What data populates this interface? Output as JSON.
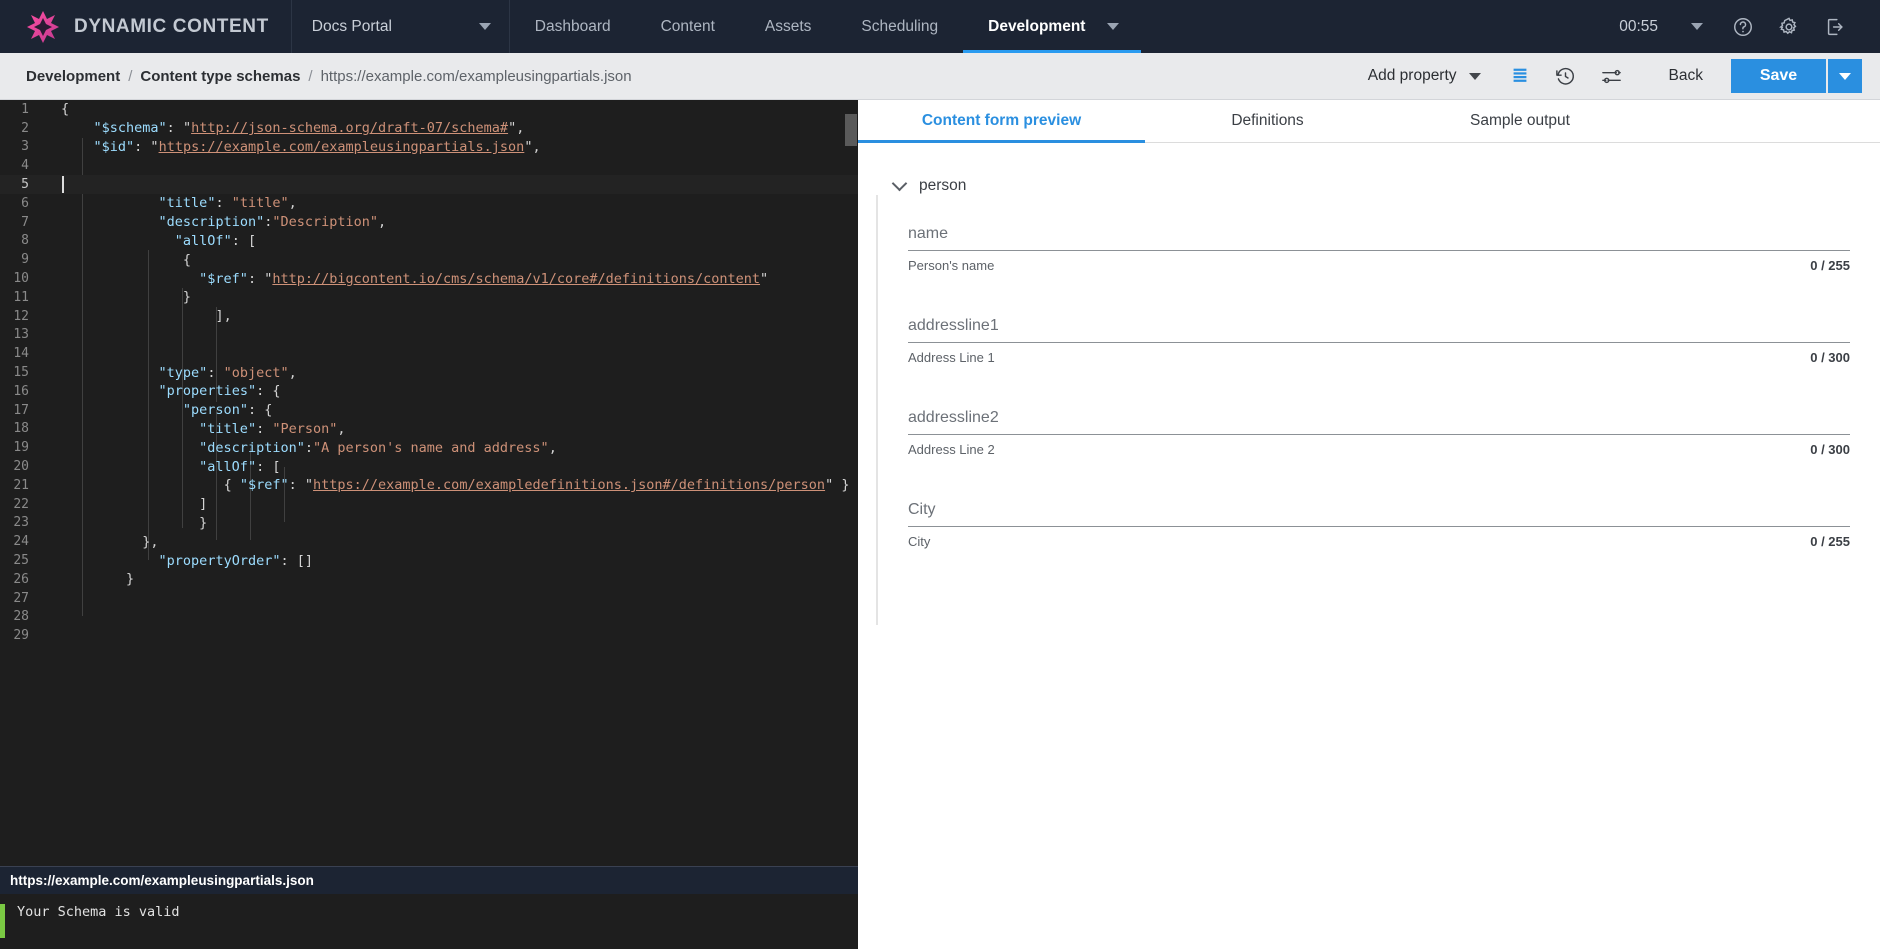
{
  "topnav": {
    "brand_name": "DYNAMIC CONTENT",
    "brand_logo_icon": "dynamic-content-star-logo",
    "site_selector": {
      "label": "Docs Portal",
      "caret_icon": "chevron-down-icon"
    },
    "tabs": [
      {
        "label": "Dashboard",
        "active": false
      },
      {
        "label": "Content",
        "active": false
      },
      {
        "label": "Assets",
        "active": false
      },
      {
        "label": "Scheduling",
        "active": false
      },
      {
        "label": "Development",
        "active": true
      }
    ],
    "overflow_caret_icon": "chevron-down-icon",
    "clock": "00:55",
    "clock_caret_icon": "chevron-down-icon",
    "help_icon": "help-circle-icon",
    "settings_icon": "gear-icon",
    "logout_icon": "logout-icon"
  },
  "subbar": {
    "breadcrumb": {
      "root": "Development",
      "sep": "/",
      "section": "Content type schemas",
      "current": "https://example.com/exampleusingpartials.json"
    },
    "add_property_label": "Add property",
    "add_property_caret_icon": "chevron-down-icon",
    "list_view_icon": "list-lines-icon",
    "history_icon": "history-clock-icon",
    "settings_sliders_icon": "sliders-icon",
    "back_label": "Back",
    "save_label": "Save",
    "save_caret_icon": "chevron-down-icon",
    "accent_color": "#2a8fe0"
  },
  "editor": {
    "total_lines": 29,
    "cursor_line": 5,
    "lines": [
      {
        "n": 1,
        "tokens": [
          {
            "t": "punc",
            "v": "{"
          }
        ],
        "indent": 0
      },
      {
        "n": 2,
        "tokens": [
          {
            "t": "key",
            "v": "\"$schema\""
          },
          {
            "t": "punc",
            "v": ": "
          },
          {
            "t": "punc",
            "v": "\""
          },
          {
            "t": "url",
            "v": "http://json-schema.org/draft-07/schema#"
          },
          {
            "t": "punc",
            "v": "\","
          }
        ],
        "indent": 4
      },
      {
        "n": 3,
        "tokens": [
          {
            "t": "key",
            "v": "\"$id\""
          },
          {
            "t": "punc",
            "v": ": "
          },
          {
            "t": "punc",
            "v": "\""
          },
          {
            "t": "url",
            "v": "https://example.com/exampleusingpartials.json"
          },
          {
            "t": "punc",
            "v": "\","
          }
        ],
        "indent": 4
      },
      {
        "n": 4,
        "tokens": [],
        "indent": 0
      },
      {
        "n": 5,
        "tokens": [],
        "indent": 0
      },
      {
        "n": 6,
        "tokens": [
          {
            "t": "key",
            "v": "\"title\""
          },
          {
            "t": "punc",
            "v": ": "
          },
          {
            "t": "str",
            "v": "\"title\""
          },
          {
            "t": "punc",
            "v": ","
          }
        ],
        "indent": 12
      },
      {
        "n": 7,
        "tokens": [
          {
            "t": "key",
            "v": "\"description\""
          },
          {
            "t": "punc",
            "v": ":"
          },
          {
            "t": "str",
            "v": "\"Description\""
          },
          {
            "t": "punc",
            "v": ","
          }
        ],
        "indent": 12
      },
      {
        "n": 8,
        "tokens": [
          {
            "t": "key",
            "v": "\"allOf\""
          },
          {
            "t": "punc",
            "v": ": ["
          }
        ],
        "indent": 14
      },
      {
        "n": 9,
        "tokens": [
          {
            "t": "punc",
            "v": "{"
          }
        ],
        "indent": 15
      },
      {
        "n": 10,
        "tokens": [
          {
            "t": "key",
            "v": "\"$ref\""
          },
          {
            "t": "punc",
            "v": ": "
          },
          {
            "t": "punc",
            "v": "\""
          },
          {
            "t": "url",
            "v": "http://bigcontent.io/cms/schema/v1/core#/definitions/content"
          },
          {
            "t": "punc",
            "v": "\""
          }
        ],
        "indent": 17
      },
      {
        "n": 11,
        "tokens": [
          {
            "t": "punc",
            "v": "}"
          }
        ],
        "indent": 15
      },
      {
        "n": 12,
        "tokens": [
          {
            "t": "punc",
            "v": "],"
          }
        ],
        "indent": 19
      },
      {
        "n": 13,
        "tokens": [],
        "indent": 0
      },
      {
        "n": 14,
        "tokens": [],
        "indent": 0
      },
      {
        "n": 15,
        "tokens": [
          {
            "t": "key",
            "v": "\"type\""
          },
          {
            "t": "punc",
            "v": ": "
          },
          {
            "t": "str",
            "v": "\"object\""
          },
          {
            "t": "punc",
            "v": ","
          }
        ],
        "indent": 12
      },
      {
        "n": 16,
        "tokens": [
          {
            "t": "key",
            "v": "\"properties\""
          },
          {
            "t": "punc",
            "v": ": {"
          }
        ],
        "indent": 12
      },
      {
        "n": 17,
        "tokens": [
          {
            "t": "key",
            "v": "\"person\""
          },
          {
            "t": "punc",
            "v": ": {"
          }
        ],
        "indent": 15
      },
      {
        "n": 18,
        "tokens": [
          {
            "t": "key",
            "v": "\"title\""
          },
          {
            "t": "punc",
            "v": ": "
          },
          {
            "t": "str",
            "v": "\"Person\""
          },
          {
            "t": "punc",
            "v": ","
          }
        ],
        "indent": 17
      },
      {
        "n": 19,
        "tokens": [
          {
            "t": "key",
            "v": "\"description\""
          },
          {
            "t": "punc",
            "v": ":"
          },
          {
            "t": "str",
            "v": "\"A person's name and address\""
          },
          {
            "t": "punc",
            "v": ","
          }
        ],
        "indent": 17
      },
      {
        "n": 20,
        "tokens": [
          {
            "t": "key",
            "v": "\"allOf\""
          },
          {
            "t": "punc",
            "v": ": ["
          }
        ],
        "indent": 17
      },
      {
        "n": 21,
        "tokens": [
          {
            "t": "punc",
            "v": "{ "
          },
          {
            "t": "key",
            "v": "\"$ref\""
          },
          {
            "t": "punc",
            "v": ": "
          },
          {
            "t": "punc",
            "v": "\""
          },
          {
            "t": "url",
            "v": "https://example.com/exampledefinitions.json#/definitions/person"
          },
          {
            "t": "punc",
            "v": "\" }"
          }
        ],
        "indent": 20
      },
      {
        "n": 22,
        "tokens": [
          {
            "t": "punc",
            "v": "]"
          }
        ],
        "indent": 17
      },
      {
        "n": 23,
        "tokens": [
          {
            "t": "punc",
            "v": "}"
          }
        ],
        "indent": 17
      },
      {
        "n": 24,
        "tokens": [
          {
            "t": "punc",
            "v": "},"
          }
        ],
        "indent": 10
      },
      {
        "n": 25,
        "tokens": [
          {
            "t": "key",
            "v": "\"propertyOrder\""
          },
          {
            "t": "punc",
            "v": ": []"
          }
        ],
        "indent": 12
      },
      {
        "n": 26,
        "tokens": [
          {
            "t": "punc",
            "v": "}"
          }
        ],
        "indent": 8
      },
      {
        "n": 27,
        "tokens": [],
        "indent": 0
      },
      {
        "n": 28,
        "tokens": [],
        "indent": 0
      },
      {
        "n": 29,
        "tokens": [],
        "indent": 0
      }
    ],
    "status_url": "https://example.com/exampleusingpartials.json",
    "validation_message": "Your Schema is valid",
    "validation_color": "#7ac943"
  },
  "preview": {
    "tabs": [
      {
        "label": "Content form preview",
        "active": true
      },
      {
        "label": "Definitions",
        "active": false
      },
      {
        "label": "Sample output",
        "active": false
      }
    ],
    "group": {
      "title": "person",
      "collapse_icon": "chevron-down-icon",
      "fields": [
        {
          "label": "name",
          "value": "",
          "hint": "Person's name",
          "count": "0 / 255"
        },
        {
          "label": "addressline1",
          "value": "",
          "hint": "Address Line 1",
          "count": "0 / 300"
        },
        {
          "label": "addressline2",
          "value": "",
          "hint": "Address Line 2",
          "count": "0 / 300"
        },
        {
          "label": "City",
          "value": "",
          "hint": "City",
          "count": "0 / 255"
        }
      ]
    }
  }
}
